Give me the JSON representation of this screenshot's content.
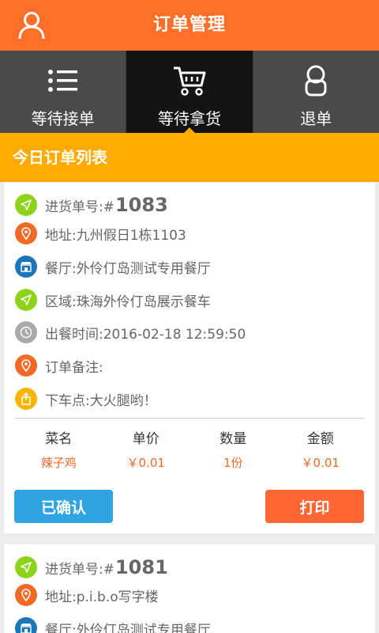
{
  "header": {
    "title": "订单管理",
    "user_icon": "user-icon"
  },
  "tabs": [
    {
      "label": "等待接单",
      "icon": "list-icon",
      "active": false
    },
    {
      "label": "等待拿货",
      "icon": "cart-icon",
      "active": true
    },
    {
      "label": "退单",
      "icon": "return-icon",
      "active": false
    }
  ],
  "section_title": "今日订单列表",
  "orders": [
    {
      "order_label": "进货单号:#",
      "order_no": "1083",
      "address": "地址:九州假日1栋1103",
      "restaurant": "餐厅:外伶仃岛测试专用餐厅",
      "area": "区域:珠海外伶仃岛展示餐车",
      "meal_time": "出餐时间:2016-02-18 12:59:50",
      "remark": "订单备注:",
      "dropoff": "下车点:大火腿哟！",
      "table_headers": [
        "菜名",
        "单价",
        "数量",
        "金额"
      ],
      "items": [
        {
          "name": "辣子鸡",
          "price": "￥0.01",
          "qty": "1份",
          "amount": "￥0.01"
        }
      ],
      "confirm_label": "已确认",
      "print_label": "打印"
    },
    {
      "order_label": "进货单号:#",
      "order_no": "1081",
      "address": "地址:p.i.b.o写字楼",
      "restaurant": "餐厅:外伶仃岛测试专用餐厅"
    }
  ],
  "colors": {
    "header": "#ff6f2a",
    "section": "#ffaa00",
    "confirm": "#2fa4e0",
    "print": "#ff6633"
  }
}
